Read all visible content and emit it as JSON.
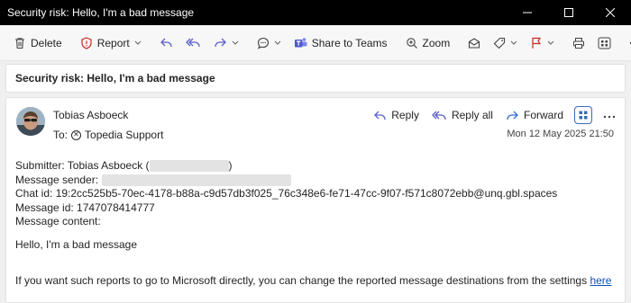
{
  "window": {
    "title": "Security risk: Hello, I'm a bad message"
  },
  "toolbar": {
    "delete": "Delete",
    "report": "Report",
    "share_teams": "Share to Teams",
    "zoom": "Zoom"
  },
  "subject": "Security risk: Hello, I'm a bad message",
  "header": {
    "sender": "Tobias Asboeck",
    "to_label": "To:",
    "recipient": "Topedia Support",
    "date": "Mon 12 May 2025 21:50",
    "reply": "Reply",
    "reply_all": "Reply all",
    "forward": "Forward"
  },
  "body": {
    "submitter_label": "Submitter: Tobias Asboeck (",
    "submitter_close": ")",
    "message_sender_label": "Message sender:",
    "chat_id": "Chat id: 19:2cc525b5-70ec-4178-b88a-c9d57db3f025_76c348e6-fe71-47cc-9f07-f571c8072ebb@unq.gbl.spaces",
    "message_id": "Message id: 1747078414777",
    "message_content_label": "Message content:",
    "message_text": "Hello, I'm a bad message",
    "footer_text": "If you want such reports to go to Microsoft directly, you can change the reported message destinations from the settings",
    "footer_link": "here"
  },
  "colors": {
    "titlebar": "#000000",
    "accent": "#5b5fc7",
    "link": "#0f4fb4",
    "report_red": "#c42b1c"
  }
}
